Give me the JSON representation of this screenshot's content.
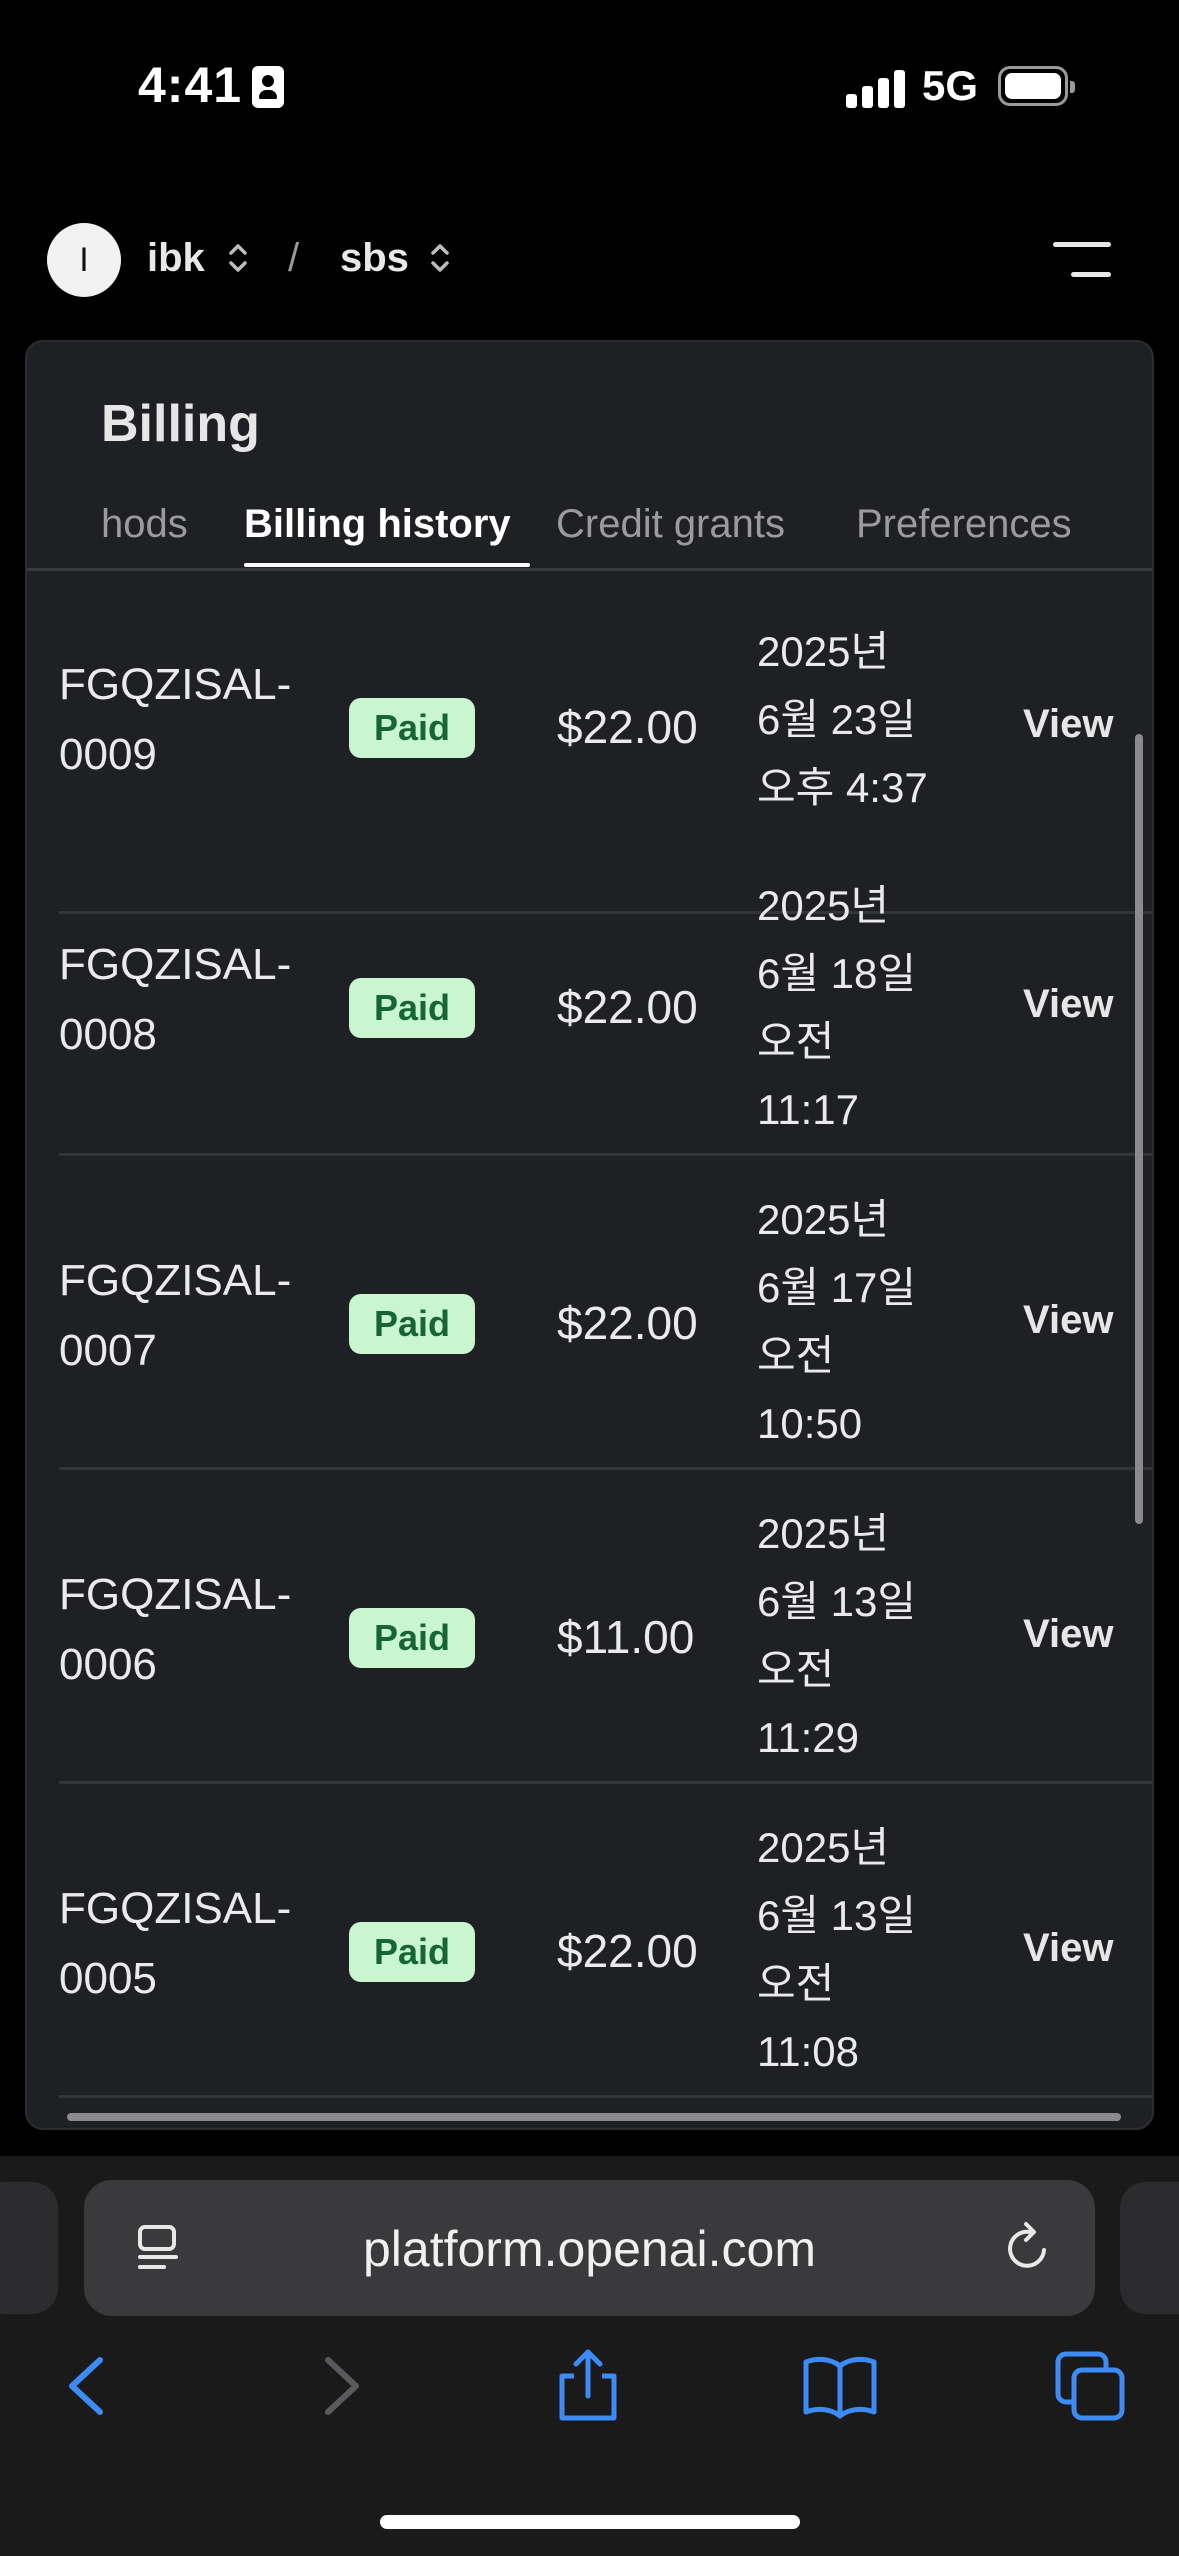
{
  "status_bar": {
    "time": "4:41",
    "network": "5G"
  },
  "topnav": {
    "avatar_initial": "I",
    "org": "ibk",
    "separator": "/",
    "project": "sbs"
  },
  "billing": {
    "title": "Billing",
    "tabs": [
      {
        "label": "hods",
        "active": false
      },
      {
        "label": "Billing history",
        "active": true
      },
      {
        "label": "Credit grants",
        "active": false
      },
      {
        "label": "Preferences",
        "active": false
      }
    ],
    "rows": [
      {
        "invoice_line1": "FGQZISAL-",
        "invoice_line2": "0009",
        "status": "Paid",
        "amount": "$22.00",
        "date_lines": [
          "2025년",
          "6월 23일",
          "오후 4:37"
        ],
        "action": "View"
      },
      {
        "invoice_line1": "FGQZISAL-",
        "invoice_line2": "0008",
        "status": "Paid",
        "amount": "$22.00",
        "date_lines": [
          "2025년",
          "6월 18일",
          "오전",
          "11:17"
        ],
        "action": "View"
      },
      {
        "invoice_line1": "FGQZISAL-",
        "invoice_line2": "0007",
        "status": "Paid",
        "amount": "$22.00",
        "date_lines": [
          "2025년",
          "6월 17일",
          "오전",
          "10:50"
        ],
        "action": "View"
      },
      {
        "invoice_line1": "FGQZISAL-",
        "invoice_line2": "0006",
        "status": "Paid",
        "amount": "$11.00",
        "date_lines": [
          "2025년",
          "6월 13일",
          "오전",
          "11:29"
        ],
        "action": "View"
      },
      {
        "invoice_line1": "FGQZISAL-",
        "invoice_line2": "0005",
        "status": "Paid",
        "amount": "$22.00",
        "date_lines": [
          "2025년",
          "6월 13일",
          "오전",
          "11:08"
        ],
        "action": "View"
      }
    ]
  },
  "browser": {
    "url": "platform.openai.com"
  },
  "colors": {
    "accent_blue": "#3d8cf5",
    "paid_bg": "#c9f6cf",
    "paid_text": "#166534"
  }
}
